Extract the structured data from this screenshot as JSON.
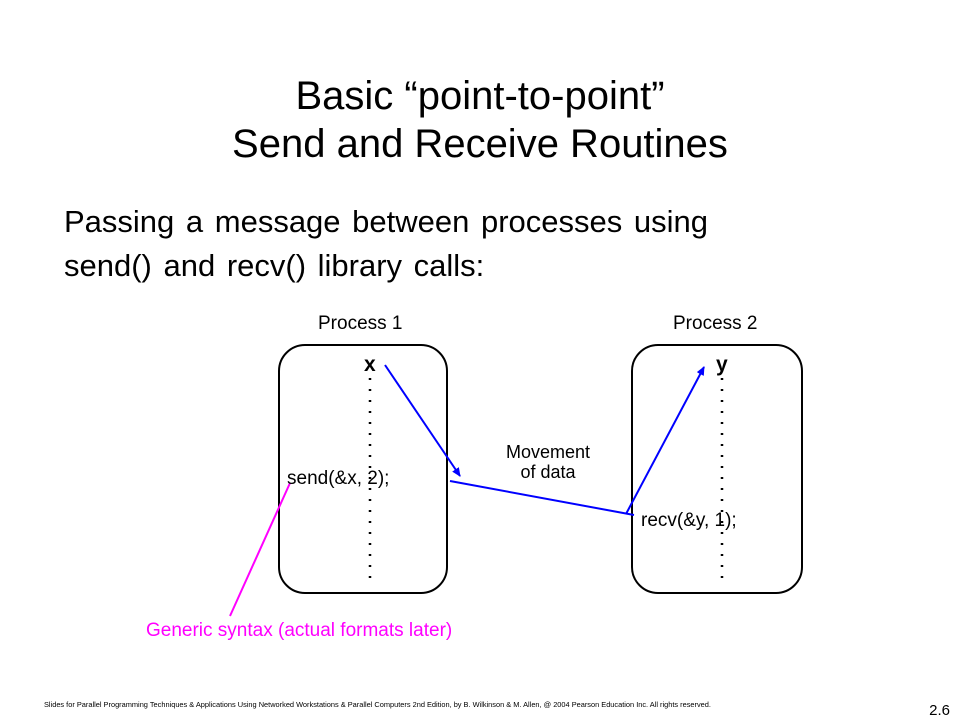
{
  "slide": {
    "title_line1": "Basic “point-to-point”",
    "title_line2": "Send and Receive Routines",
    "intro_line1": "Passing a message between processes using",
    "intro_line2": "send() and recv() library calls:",
    "footer": "Slides for Parallel Programming Techniques & Applications Using Networked Workstations & Parallel Computers 2nd Edition, by B. Wilkinson & M. Allen, @ 2004 Pearson Education Inc. All rights reserved.",
    "page_number": "2.6"
  },
  "diagram": {
    "process1": {
      "label": "Process 1",
      "variable": "x",
      "call": "send(&x, 2);"
    },
    "process2": {
      "label": "Process 2",
      "variable": "y",
      "call": "recv(&y, 1);"
    },
    "movement_line1": "Movement",
    "movement_line2": "of data",
    "annotation": "Generic syntax (actual formats later)",
    "colors": {
      "arrow": "#0000ff",
      "annotation": "#ff00ff",
      "box": "#000000"
    }
  }
}
